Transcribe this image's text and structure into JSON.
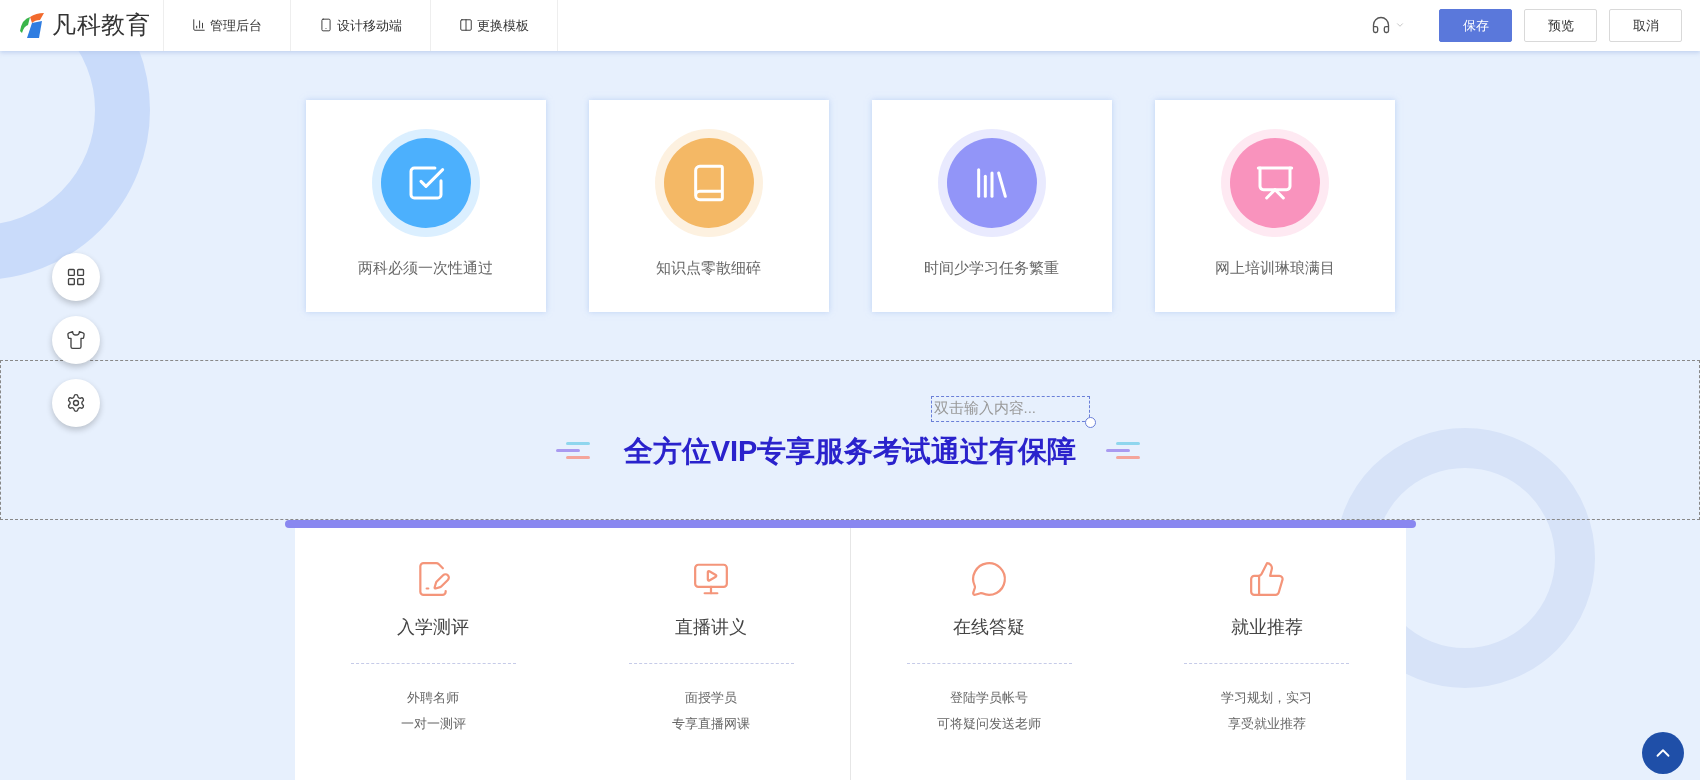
{
  "header": {
    "logo_text": "凡科教育",
    "nav": [
      {
        "label": "管理后台"
      },
      {
        "label": "设计移动端"
      },
      {
        "label": "更换模板"
      }
    ],
    "buttons": [
      {
        "label": "保存",
        "kind": "primary"
      },
      {
        "label": "预览",
        "kind": "default"
      },
      {
        "label": "取消",
        "kind": "default"
      }
    ]
  },
  "features": [
    {
      "label": "两科必须一次性通过",
      "color": "#4cb0fd"
    },
    {
      "label": "知识点零散细碎",
      "color": "#f4b865"
    },
    {
      "label": "时间少学习任务繁重",
      "color": "#9295f8"
    },
    {
      "label": "网上培训琳琅满目",
      "color": "#f993bd"
    }
  ],
  "banner": {
    "placeholder": "双击输入内容...",
    "title": "全方位VIP专享服务考试通过有保障"
  },
  "services": [
    {
      "title": "入学测评",
      "lines": [
        "外聘名师",
        "一对一测评"
      ]
    },
    {
      "title": "直播讲义",
      "lines": [
        "面授学员",
        "专享直播网课"
      ]
    },
    {
      "title": "在线答疑",
      "lines": [
        "登陆学员帐号",
        "可将疑问发送老师"
      ]
    },
    {
      "title": "就业推荐",
      "lines": [
        "学习规划，实习",
        "享受就业推荐"
      ]
    }
  ]
}
